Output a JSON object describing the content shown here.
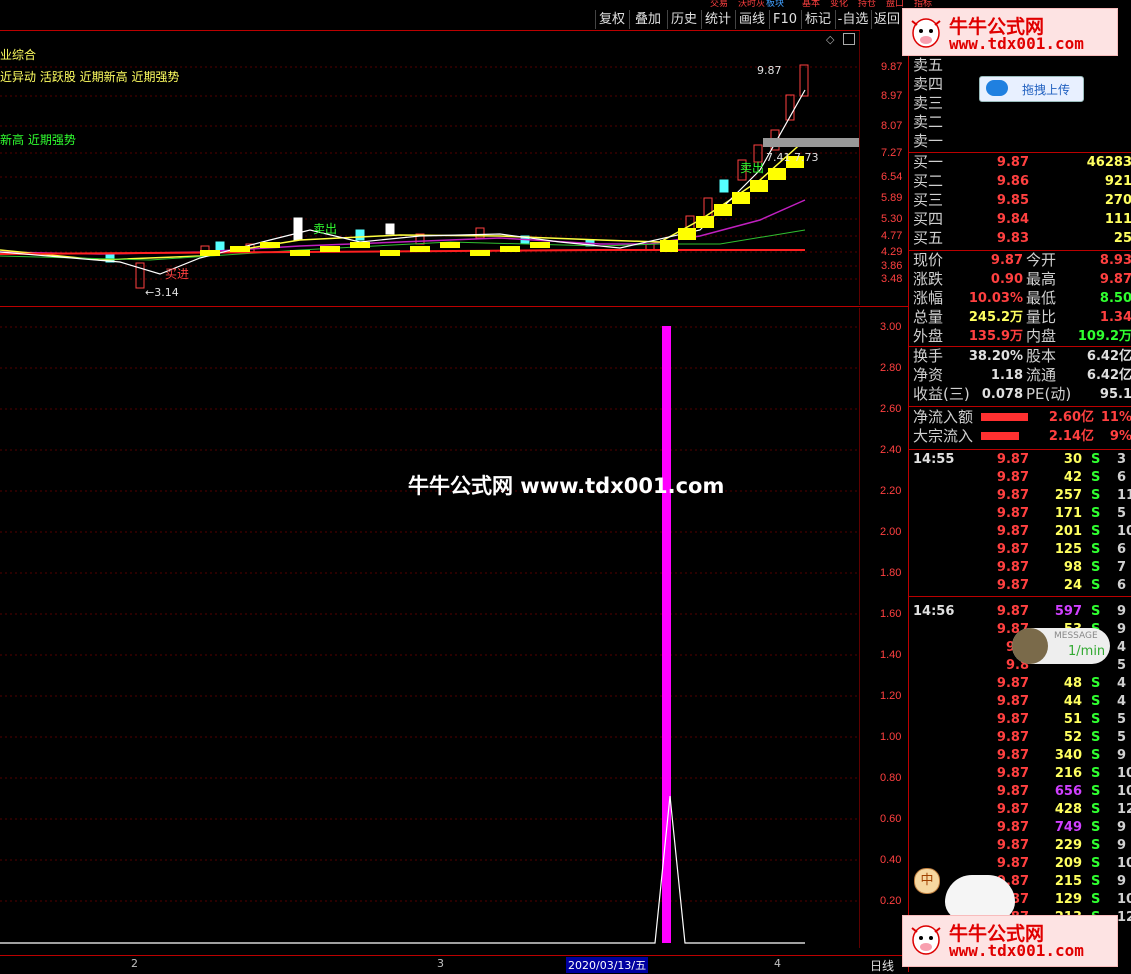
{
  "toolbar": {
    "buttons": [
      "复权",
      "叠加",
      "历史",
      "统计",
      "画线",
      "F10",
      "标记",
      "-自选",
      "返回"
    ],
    "top_tabs": [
      "交易",
      "沃时灰",
      "板块",
      "基本",
      "变化",
      "持仓",
      "盘口",
      "指标"
    ]
  },
  "main_chart": {
    "legend_line1": "业综合",
    "legend_line2": "近异动 活跃股 近期新高 近期强势",
    "legend_line3": "新高 近期强势",
    "labels": {
      "high_value": "9.87",
      "low_value": "3.14",
      "mid_value": "7.41",
      "mid_value2": "7.73",
      "sell_1": "卖出",
      "sell_2": "卖出",
      "buy_1": "买进"
    },
    "y_ticks": [
      "9.87",
      "8.97",
      "8.07",
      "7.27",
      "6.54",
      "5.89",
      "5.30",
      "4.77",
      "4.29",
      "3.86",
      "3.48"
    ]
  },
  "indicator_chart": {
    "y_ticks": [
      "3.00",
      "2.80",
      "2.60",
      "2.40",
      "2.20",
      "2.00",
      "1.80",
      "1.60",
      "1.40",
      "1.20",
      "1.00",
      "0.80",
      "0.60",
      "0.40",
      "0.20"
    ]
  },
  "watermark": "牛牛公式网 www.tdx001.com",
  "logo": {
    "title": "牛牛公式网",
    "url": "www.tdx001.com"
  },
  "upload_button": "拖拽上传",
  "orderbook": {
    "sells": [
      {
        "label": "卖五",
        "price": "",
        "vol": ""
      },
      {
        "label": "卖四",
        "price": "",
        "vol": ""
      },
      {
        "label": "卖三",
        "price": "",
        "vol": ""
      },
      {
        "label": "卖二",
        "price": "",
        "vol": ""
      },
      {
        "label": "卖一",
        "price": "",
        "vol": ""
      }
    ],
    "buys": [
      {
        "label": "买一",
        "price": "9.87",
        "vol": "46283"
      },
      {
        "label": "买二",
        "price": "9.86",
        "vol": "921"
      },
      {
        "label": "买三",
        "price": "9.85",
        "vol": "270"
      },
      {
        "label": "买四",
        "price": "9.84",
        "vol": "111"
      },
      {
        "label": "买五",
        "price": "9.83",
        "vol": "25"
      }
    ]
  },
  "quote": [
    {
      "l1": "现价",
      "v1": "9.87",
      "c1": "#ff4040",
      "l2": "今开",
      "v2": "8.93",
      "c2": "#ff4040"
    },
    {
      "l1": "涨跌",
      "v1": "0.90",
      "c1": "#ff4040",
      "l2": "最高",
      "v2": "9.87",
      "c2": "#ff4040"
    },
    {
      "l1": "涨幅",
      "v1": "10.03%",
      "c1": "#ff4040",
      "l2": "最低",
      "v2": "8.50",
      "c2": "#30ff30"
    },
    {
      "l1": "总量",
      "v1": "245.2万",
      "c1": "#ffff60",
      "l2": "量比",
      "v2": "1.34",
      "c2": "#ff4040"
    },
    {
      "l1": "外盘",
      "v1": "135.9万",
      "c1": "#ff4040",
      "l2": "内盘",
      "v2": "109.2万",
      "c2": "#30ff30"
    }
  ],
  "fund": [
    {
      "l1": "换手",
      "v1": "38.20%",
      "c1": "#e0e0e0",
      "l2": "股本",
      "v2": "6.42亿",
      "c2": "#e0e0e0"
    },
    {
      "l1": "净资",
      "v1": "1.18",
      "c1": "#e0e0e0",
      "l2": "流通",
      "v2": "6.42亿",
      "c2": "#e0e0e0"
    },
    {
      "l1": "收益(三)",
      "v1": "0.078",
      "c1": "#e0e0e0",
      "l2": "PE(动)",
      "v2": "95.1",
      "c2": "#e0e0e0"
    }
  ],
  "flow": [
    {
      "label": "净流入额",
      "value": "2.60亿",
      "pct": "11%",
      "bar_fraction": 0.62
    },
    {
      "label": "大宗流入",
      "value": "2.14亿",
      "pct": "9%",
      "bar_fraction": 0.51
    }
  ],
  "ticks": [
    {
      "time": "14:55",
      "price": "9.87",
      "vol": "30",
      "side": "S",
      "cnt": "3",
      "hl": false
    },
    {
      "time": "",
      "price": "9.87",
      "vol": "42",
      "side": "S",
      "cnt": "6",
      "hl": false
    },
    {
      "time": "",
      "price": "9.87",
      "vol": "257",
      "side": "S",
      "cnt": "11",
      "hl": false
    },
    {
      "time": "",
      "price": "9.87",
      "vol": "171",
      "side": "S",
      "cnt": "5",
      "hl": false
    },
    {
      "time": "",
      "price": "9.87",
      "vol": "201",
      "side": "S",
      "cnt": "10",
      "hl": false
    },
    {
      "time": "",
      "price": "9.87",
      "vol": "125",
      "side": "S",
      "cnt": "6",
      "hl": false
    },
    {
      "time": "",
      "price": "9.87",
      "vol": "98",
      "side": "S",
      "cnt": "7",
      "hl": false
    },
    {
      "time": "",
      "price": "9.87",
      "vol": "24",
      "side": "S",
      "cnt": "6",
      "hl": false
    },
    {
      "time": "14:56",
      "price": "9.87",
      "vol": "597",
      "side": "S",
      "cnt": "9",
      "hl": true
    },
    {
      "time": "",
      "price": "9.87",
      "vol": "53",
      "side": "S",
      "cnt": "9",
      "hl": false
    },
    {
      "time": "",
      "price": "9.8",
      "vol": "",
      "side": "",
      "cnt": "4",
      "hl": false
    },
    {
      "time": "",
      "price": "9.8",
      "vol": "",
      "side": "",
      "cnt": "5",
      "hl": false
    },
    {
      "time": "",
      "price": "9.87",
      "vol": "48",
      "side": "S",
      "cnt": "4",
      "hl": false
    },
    {
      "time": "",
      "price": "9.87",
      "vol": "44",
      "side": "S",
      "cnt": "4",
      "hl": false
    },
    {
      "time": "",
      "price": "9.87",
      "vol": "51",
      "side": "S",
      "cnt": "5",
      "hl": false
    },
    {
      "time": "",
      "price": "9.87",
      "vol": "52",
      "side": "S",
      "cnt": "5",
      "hl": false
    },
    {
      "time": "",
      "price": "9.87",
      "vol": "340",
      "side": "S",
      "cnt": "9",
      "hl": false
    },
    {
      "time": "",
      "price": "9.87",
      "vol": "216",
      "side": "S",
      "cnt": "10",
      "hl": false
    },
    {
      "time": "",
      "price": "9.87",
      "vol": "656",
      "side": "S",
      "cnt": "10",
      "hl": true
    },
    {
      "time": "",
      "price": "9.87",
      "vol": "428",
      "side": "S",
      "cnt": "12",
      "hl": false
    },
    {
      "time": "",
      "price": "9.87",
      "vol": "749",
      "side": "S",
      "cnt": "9",
      "hl": true
    },
    {
      "time": "",
      "price": "9.87",
      "vol": "229",
      "side": "S",
      "cnt": "9",
      "hl": false
    },
    {
      "time": "",
      "price": "9.87",
      "vol": "209",
      "side": "S",
      "cnt": "10",
      "hl": false
    },
    {
      "time": "",
      "price": "9.87",
      "vol": "215",
      "side": "S",
      "cnt": "9",
      "hl": false
    },
    {
      "time": "",
      "price": "9.87",
      "vol": "129",
      "side": "S",
      "cnt": "10",
      "hl": false
    },
    {
      "time": "",
      "price": "9.87",
      "vol": "213",
      "side": "S",
      "cnt": "12",
      "hl": false
    }
  ],
  "message_widget": {
    "title": "MESSAGE",
    "rate": "1/min"
  },
  "bottom": {
    "dates": [
      "2",
      "3",
      "2020/03/13/五",
      "4"
    ],
    "period": "日线"
  },
  "colors": {
    "up": "#ff4040",
    "down": "#30ff30",
    "accent": "#ff00ff",
    "grid": "#b00000"
  }
}
